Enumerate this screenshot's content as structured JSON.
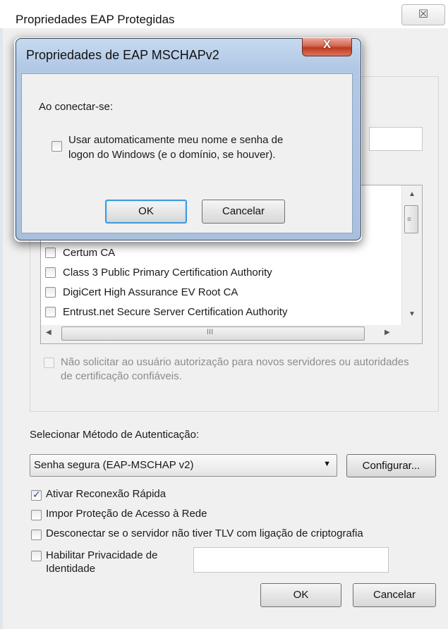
{
  "outer_dialog": {
    "title": "Propriedades EAP Protegidas",
    "close_glyph": "☒",
    "cert_list": {
      "items": [
        {
          "label": "Certum CA",
          "checked": false
        },
        {
          "label": "Class 3 Public Primary Certification Authority",
          "checked": false
        },
        {
          "label": "DigiCert High Assurance EV Root CA",
          "checked": false
        },
        {
          "label": "Entrust.net Secure Server Certification Authority",
          "checked": false
        }
      ],
      "hscroll_grip": "III"
    },
    "no_prompt_label": "Não solicitar ao usuário autorização para novos servidores ou autoridades de certificação confiáveis.",
    "auth_method_label": "Selecionar Método de Autenticação:",
    "auth_method_value": "Senha segura (EAP-MSCHAP v2)",
    "configure_label": "Configurar...",
    "options": {
      "fast_reconnect": {
        "label": "Ativar Reconexão Rápida",
        "checked": true
      },
      "nap": {
        "label": "Impor Proteção de Acesso à Rede",
        "checked": false
      },
      "disconnect_tlv": {
        "label": "Desconectar se o servidor não tiver TLV com ligação de criptografia",
        "checked": false
      },
      "identity_privacy": {
        "label_line1": "Habilitar Privacidade de",
        "label_line2": "Identidade",
        "checked": false
      }
    },
    "ok_label": "OK",
    "cancel_label": "Cancelar"
  },
  "inner_dialog": {
    "title": "Propriedades de EAP MSCHAPv2",
    "close_glyph": "X",
    "connect_label": "Ao conectar-se:",
    "auto_logon_line1": "Usar automaticamente meu nome e senha de",
    "auto_logon_line2": "logon do Windows (e o domínio, se houver).",
    "auto_logon_checked": false,
    "ok_label": "OK",
    "cancel_label": "Cancelar"
  }
}
